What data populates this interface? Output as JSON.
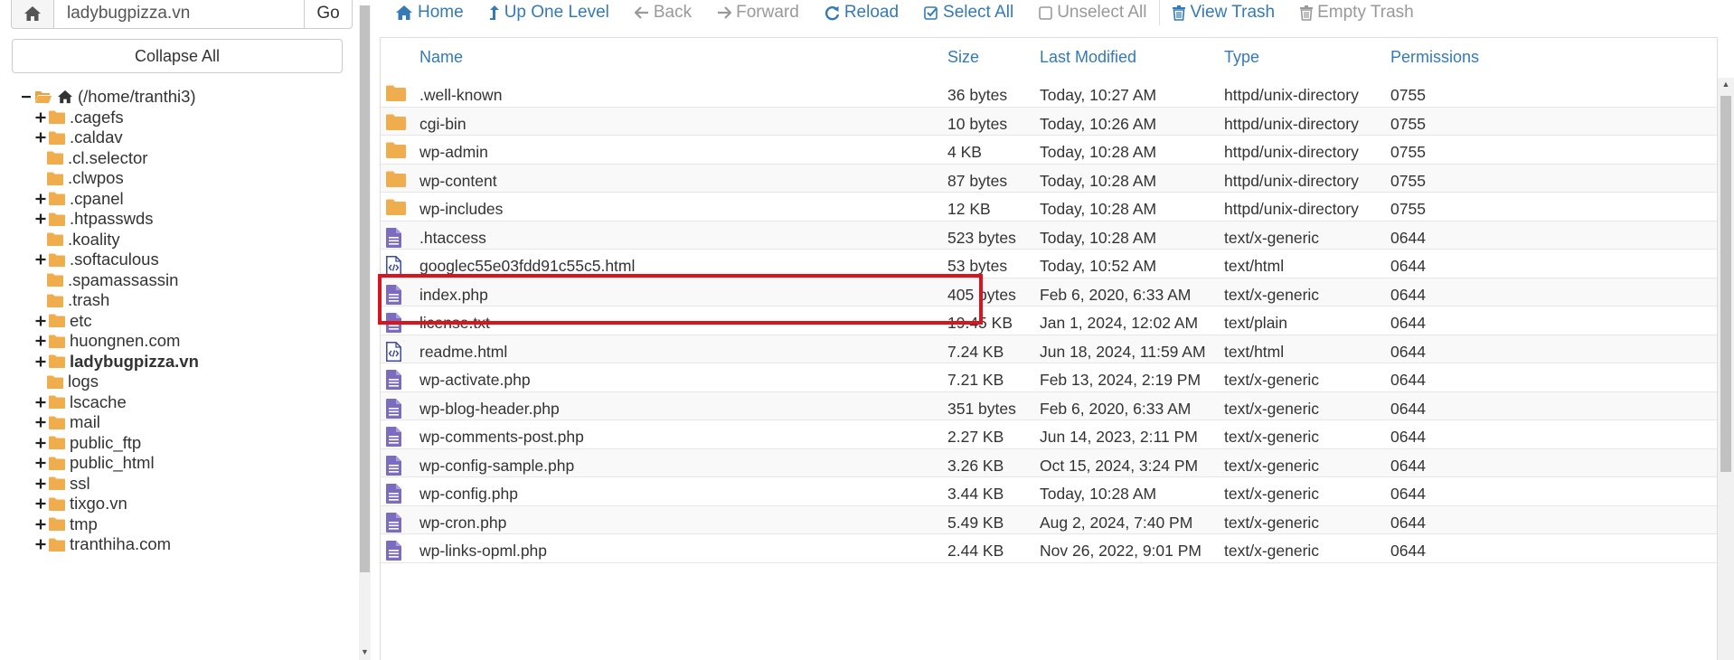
{
  "path_bar": {
    "path_value": "ladybugpizza.vn",
    "go_label": "Go"
  },
  "collapse_label": "Collapse All",
  "tree": {
    "root_label": "(/home/tranthi3)",
    "items": [
      {
        "label": ".cagefs",
        "expandable": true,
        "bold": false
      },
      {
        "label": ".caldav",
        "expandable": true,
        "bold": false
      },
      {
        "label": ".cl.selector",
        "expandable": false,
        "bold": false
      },
      {
        "label": ".clwpos",
        "expandable": false,
        "bold": false
      },
      {
        "label": ".cpanel",
        "expandable": true,
        "bold": false
      },
      {
        "label": ".htpasswds",
        "expandable": true,
        "bold": false
      },
      {
        "label": ".koality",
        "expandable": false,
        "bold": false
      },
      {
        "label": ".softaculous",
        "expandable": true,
        "bold": false
      },
      {
        "label": ".spamassassin",
        "expandable": false,
        "bold": false
      },
      {
        "label": ".trash",
        "expandable": false,
        "bold": false
      },
      {
        "label": "etc",
        "expandable": true,
        "bold": false
      },
      {
        "label": "huongnen.com",
        "expandable": true,
        "bold": false
      },
      {
        "label": "ladybugpizza.vn",
        "expandable": true,
        "bold": true
      },
      {
        "label": "logs",
        "expandable": false,
        "bold": false
      },
      {
        "label": "lscache",
        "expandable": true,
        "bold": false
      },
      {
        "label": "mail",
        "expandable": true,
        "bold": false
      },
      {
        "label": "public_ftp",
        "expandable": true,
        "bold": false
      },
      {
        "label": "public_html",
        "expandable": true,
        "bold": false
      },
      {
        "label": "ssl",
        "expandable": true,
        "bold": false
      },
      {
        "label": "tixgo.vn",
        "expandable": true,
        "bold": false
      },
      {
        "label": "tmp",
        "expandable": true,
        "bold": false
      },
      {
        "label": "tranthiha.com",
        "expandable": true,
        "bold": false
      }
    ]
  },
  "toolbar": {
    "home": "Home",
    "up_one_level": "Up One Level",
    "back": "Back",
    "forward": "Forward",
    "reload": "Reload",
    "select_all": "Select All",
    "unselect_all": "Unselect All",
    "view_trash": "View Trash",
    "empty_trash": "Empty Trash"
  },
  "table": {
    "headers": {
      "name": "Name",
      "size": "Size",
      "modified": "Last Modified",
      "type": "Type",
      "permissions": "Permissions"
    },
    "rows": [
      {
        "icon": "folder-icon",
        "name": ".well-known",
        "size": "36 bytes",
        "modified": "Today, 10:27 AM",
        "type": "httpd/unix-directory",
        "perm": "0755"
      },
      {
        "icon": "folder-icon",
        "name": "cgi-bin",
        "size": "10 bytes",
        "modified": "Today, 10:26 AM",
        "type": "httpd/unix-directory",
        "perm": "0755"
      },
      {
        "icon": "folder-icon",
        "name": "wp-admin",
        "size": "4 KB",
        "modified": "Today, 10:28 AM",
        "type": "httpd/unix-directory",
        "perm": "0755"
      },
      {
        "icon": "folder-icon",
        "name": "wp-content",
        "size": "87 bytes",
        "modified": "Today, 10:28 AM",
        "type": "httpd/unix-directory",
        "perm": "0755"
      },
      {
        "icon": "folder-icon",
        "name": "wp-includes",
        "size": "12 KB",
        "modified": "Today, 10:28 AM",
        "type": "httpd/unix-directory",
        "perm": "0755"
      },
      {
        "icon": "file-icon",
        "name": ".htaccess",
        "size": "523 bytes",
        "modified": "Today, 10:28 AM",
        "type": "text/x-generic",
        "perm": "0644"
      },
      {
        "icon": "html-file-icon",
        "name": "googlec55e03fdd91c55c5.html",
        "size": "53 bytes",
        "modified": "Today, 10:52 AM",
        "type": "text/html",
        "perm": "0644"
      },
      {
        "icon": "file-icon",
        "name": "index.php",
        "size": "405 bytes",
        "modified": "Feb 6, 2020, 6:33 AM",
        "type": "text/x-generic",
        "perm": "0644"
      },
      {
        "icon": "file-icon",
        "name": "license.txt",
        "size": "19.45 KB",
        "modified": "Jan 1, 2024, 12:02 AM",
        "type": "text/plain",
        "perm": "0644"
      },
      {
        "icon": "html-file-icon",
        "name": "readme.html",
        "size": "7.24 KB",
        "modified": "Jun 18, 2024, 11:59 AM",
        "type": "text/html",
        "perm": "0644"
      },
      {
        "icon": "file-icon",
        "name": "wp-activate.php",
        "size": "7.21 KB",
        "modified": "Feb 13, 2024, 2:19 PM",
        "type": "text/x-generic",
        "perm": "0644"
      },
      {
        "icon": "file-icon",
        "name": "wp-blog-header.php",
        "size": "351 bytes",
        "modified": "Feb 6, 2020, 6:33 AM",
        "type": "text/x-generic",
        "perm": "0644"
      },
      {
        "icon": "file-icon",
        "name": "wp-comments-post.php",
        "size": "2.27 KB",
        "modified": "Jun 14, 2023, 2:11 PM",
        "type": "text/x-generic",
        "perm": "0644"
      },
      {
        "icon": "file-icon",
        "name": "wp-config-sample.php",
        "size": "3.26 KB",
        "modified": "Oct 15, 2024, 3:24 PM",
        "type": "text/x-generic",
        "perm": "0644"
      },
      {
        "icon": "file-icon",
        "name": "wp-config.php",
        "size": "3.44 KB",
        "modified": "Today, 10:28 AM",
        "type": "text/x-generic",
        "perm": "0644"
      },
      {
        "icon": "file-icon",
        "name": "wp-cron.php",
        "size": "5.49 KB",
        "modified": "Aug 2, 2024, 7:40 PM",
        "type": "text/x-generic",
        "perm": "0644"
      },
      {
        "icon": "file-icon",
        "name": "wp-links-opml.php",
        "size": "2.44 KB",
        "modified": "Nov 26, 2022, 9:01 PM",
        "type": "text/x-generic",
        "perm": "0644"
      }
    ]
  },
  "colors": {
    "link": "#337ab7",
    "folder": "#f0ad4e",
    "file": "#7b6cbf",
    "highlight": "#d9141c",
    "disabled": "#999999"
  }
}
